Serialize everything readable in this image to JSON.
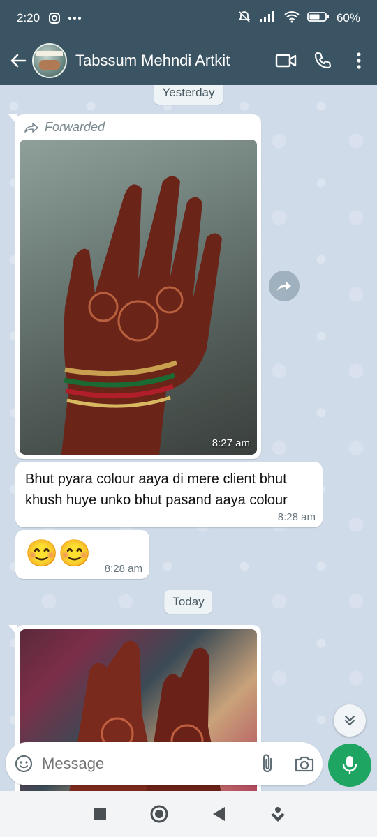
{
  "status": {
    "time": "2:20",
    "battery": "60%"
  },
  "header": {
    "title": "Tabssum Mehndi Artkit",
    "avatar_text": "TABSSUM"
  },
  "chat": {
    "date_yesterday": "Yesterday",
    "forwarded_label": "Forwarded",
    "img1_time": "8:27 am",
    "msg1": {
      "line1": "Bhut pyara colour aaya di mere client bhut",
      "line2": "khush huye unko bhut pasand aaya colour",
      "time": "8:28 am"
    },
    "msg2": {
      "text": "😊😊",
      "time": "8:28 am"
    },
    "date_today": "Today"
  },
  "composer": {
    "placeholder": "Message"
  },
  "colors": {
    "header": "#3b5463",
    "accent": "#1ea562",
    "chat_bg": "#cfdbe9"
  }
}
